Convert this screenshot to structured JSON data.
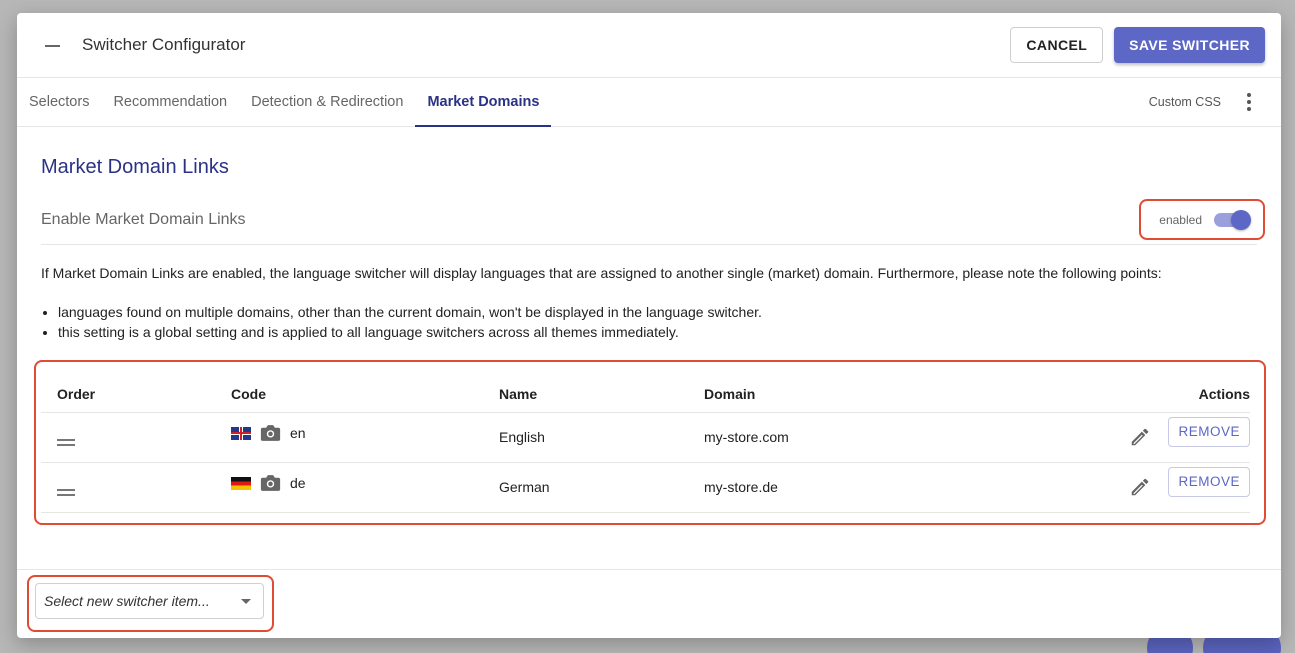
{
  "dialog": {
    "title": "Switcher Configurator",
    "cancel_label": "CANCEL",
    "save_label": "SAVE SWITCHER"
  },
  "tabs": [
    {
      "label": "Selectors",
      "active": false
    },
    {
      "label": "Recommendation",
      "active": false
    },
    {
      "label": "Detection & Redirection",
      "active": false
    },
    {
      "label": "Market Domains",
      "active": true
    }
  ],
  "custom_css_label": "Custom CSS",
  "section": {
    "title": "Market Domain Links",
    "enable_label": "Enable Market Domain Links",
    "toggle_state_text": "enabled",
    "toggle_on": true,
    "description": "If Market Domain Links are enabled, the language switcher will display languages that are assigned to another single (market) domain. Furthermore, please note the following points:",
    "bullets": [
      "languages found on multiple domains, other than the current domain, won't be displayed in the language switcher.",
      "this setting is a global setting and is applied to all language switchers across all themes immediately."
    ]
  },
  "table": {
    "headers": {
      "order": "Order",
      "code": "Code",
      "name": "Name",
      "domain": "Domain",
      "actions": "Actions"
    },
    "rows": [
      {
        "flag": "uk-flag-icon",
        "code": "en",
        "name": "English",
        "domain": "my-store.com",
        "remove_label": "REMOVE"
      },
      {
        "flag": "de-flag-icon",
        "code": "de",
        "name": "German",
        "domain": "my-store.de",
        "remove_label": "REMOVE"
      }
    ]
  },
  "footer": {
    "select_placeholder": "Select new switcher item..."
  },
  "colors": {
    "accent": "#5c67c6",
    "tab_active": "#2b3286",
    "highlight": "#e04b33"
  }
}
